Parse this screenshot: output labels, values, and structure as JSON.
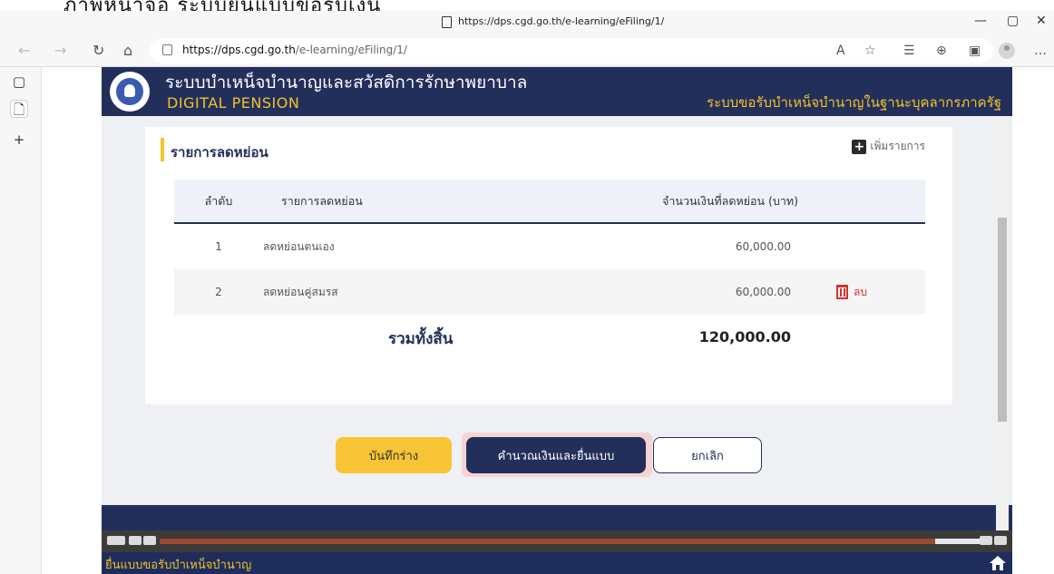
{
  "window": {
    "title_url": "https://dps.cgd.go.th/e-learning/eFiling/1/"
  },
  "address_bar": {
    "url_prefix": "https://dps.cgd.go.th",
    "url_path": "/e-learning/eFiling/1/"
  },
  "header": {
    "system_name": "ระบบบำเหน็จบำนาญและสวัสดิการรักษาพยาบาล",
    "subtitle": "DIGITAL PENSION",
    "right_text": "ระบบขอรับบำเหน็จบำนาญในฐานะบุคลากรภาครัฐ"
  },
  "section": {
    "title": "รายการลดหย่อน",
    "add_label": "เพิ่มรายการ"
  },
  "table": {
    "headers": {
      "index": "ลำดับ",
      "item": "รายการลดหย่อน",
      "amount": "จำนวนเงินที่ลดหย่อน (บาท)"
    },
    "rows": [
      {
        "index": "1",
        "item": "ลดหย่อนตนเอง",
        "amount": "60,000.00",
        "action": ""
      },
      {
        "index": "2",
        "item": "ลดหย่อนคู่สมรส",
        "amount": "60,000.00",
        "action": "ลบ"
      }
    ],
    "total_label": "รวมทั้งสิ้น",
    "total_value": "120,000.00"
  },
  "buttons": {
    "draft": "บันทึกร่าง",
    "submit": "คำนวณเงินและยื่นแบบ",
    "cancel": "ยกเลิก"
  },
  "player": {
    "progress": 0.94
  },
  "status": {
    "label": "ยื่นแบบขอรับบำเหน็จบำนาญ"
  },
  "colors": {
    "navy": "#232f5b",
    "yellow": "#f4c52d",
    "danger": "#d0342c"
  }
}
